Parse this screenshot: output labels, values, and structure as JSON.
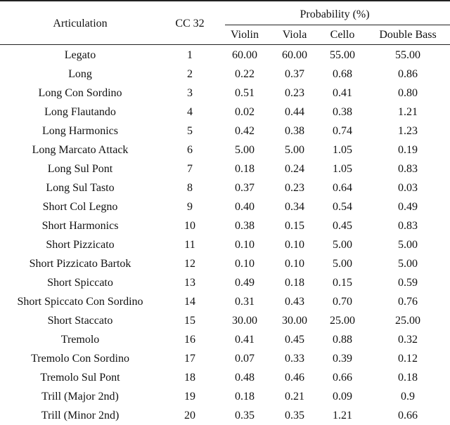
{
  "table": {
    "headers": {
      "articulation": "Articulation",
      "cc": "CC 32",
      "group": "Probability (%)",
      "instruments": [
        "Violin",
        "Viola",
        "Cello",
        "Double Bass"
      ]
    },
    "rows": [
      {
        "articulation": "Legato",
        "cc": "1",
        "violin": "60.00",
        "viola": "60.00",
        "cello": "55.00",
        "double_bass": "55.00"
      },
      {
        "articulation": "Long",
        "cc": "2",
        "violin": "0.22",
        "viola": "0.37",
        "cello": "0.68",
        "double_bass": "0.86"
      },
      {
        "articulation": "Long Con Sordino",
        "cc": "3",
        "violin": "0.51",
        "viola": "0.23",
        "cello": "0.41",
        "double_bass": "0.80"
      },
      {
        "articulation": "Long Flautando",
        "cc": "4",
        "violin": "0.02",
        "viola": "0.44",
        "cello": "0.38",
        "double_bass": "1.21"
      },
      {
        "articulation": "Long Harmonics",
        "cc": "5",
        "violin": "0.42",
        "viola": "0.38",
        "cello": "0.74",
        "double_bass": "1.23"
      },
      {
        "articulation": "Long Marcato Attack",
        "cc": "6",
        "violin": "5.00",
        "viola": "5.00",
        "cello": "1.05",
        "double_bass": "0.19"
      },
      {
        "articulation": "Long Sul Pont",
        "cc": "7",
        "violin": "0.18",
        "viola": "0.24",
        "cello": "1.05",
        "double_bass": "0.83"
      },
      {
        "articulation": "Long Sul Tasto",
        "cc": "8",
        "violin": "0.37",
        "viola": "0.23",
        "cello": "0.64",
        "double_bass": "0.03"
      },
      {
        "articulation": "Short Col Legno",
        "cc": "9",
        "violin": "0.40",
        "viola": "0.34",
        "cello": "0.54",
        "double_bass": "0.49"
      },
      {
        "articulation": "Short Harmonics",
        "cc": "10",
        "violin": "0.38",
        "viola": "0.15",
        "cello": "0.45",
        "double_bass": "0.83"
      },
      {
        "articulation": "Short Pizzicato",
        "cc": "11",
        "violin": "0.10",
        "viola": "0.10",
        "cello": "5.00",
        "double_bass": "5.00"
      },
      {
        "articulation": "Short Pizzicato Bartok",
        "cc": "12",
        "violin": "0.10",
        "viola": "0.10",
        "cello": "5.00",
        "double_bass": "5.00"
      },
      {
        "articulation": "Short Spiccato",
        "cc": "13",
        "violin": "0.49",
        "viola": "0.18",
        "cello": "0.15",
        "double_bass": "0.59"
      },
      {
        "articulation": "Short Spiccato Con Sordino",
        "cc": "14",
        "violin": "0.31",
        "viola": "0.43",
        "cello": "0.70",
        "double_bass": "0.76"
      },
      {
        "articulation": "Short Staccato",
        "cc": "15",
        "violin": "30.00",
        "viola": "30.00",
        "cello": "25.00",
        "double_bass": "25.00"
      },
      {
        "articulation": "Tremolo",
        "cc": "16",
        "violin": "0.41",
        "viola": "0.45",
        "cello": "0.88",
        "double_bass": "0.32"
      },
      {
        "articulation": "Tremolo Con Sordino",
        "cc": "17",
        "violin": "0.07",
        "viola": "0.33",
        "cello": "0.39",
        "double_bass": "0.12"
      },
      {
        "articulation": "Tremolo Sul Pont",
        "cc": "18",
        "violin": "0.48",
        "viola": "0.46",
        "cello": "0.66",
        "double_bass": "0.18"
      },
      {
        "articulation": "Trill (Major 2nd)",
        "cc": "19",
        "violin": "0.18",
        "viola": "0.21",
        "cello": "0.09",
        "double_bass": "0.9"
      },
      {
        "articulation": "Trill (Minor 2nd)",
        "cc": "20",
        "violin": "0.35",
        "viola": "0.35",
        "cello": "1.21",
        "double_bass": "0.66"
      }
    ]
  }
}
